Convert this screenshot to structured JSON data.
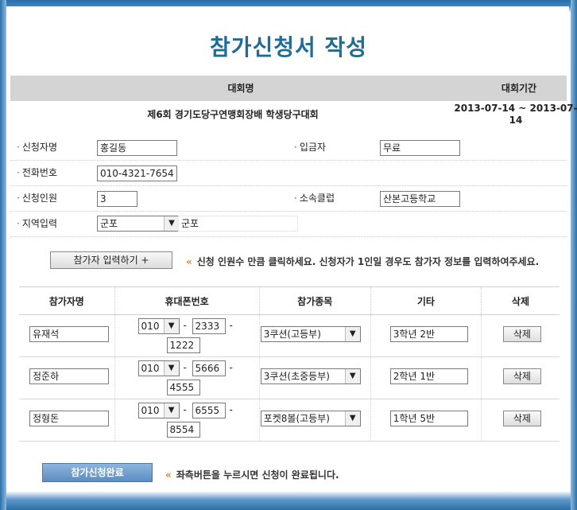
{
  "title": "참가신청서 작성",
  "event_table": {
    "col_name": "대회명",
    "col_period": "대회기간",
    "name": "제6회 경기도당구연맹회장배 학생당구대회",
    "period": "2013-07-14 ~ 2013-07-14"
  },
  "form": {
    "applicant_label": "신청자명",
    "applicant_value": "홍길동",
    "depositor_label": "입금자",
    "depositor_value": "무료",
    "phone_label": "전화번호",
    "phone_value": "010-4321-7654",
    "count_label": "신청인원",
    "count_value": "3",
    "club_label": "소속클럽",
    "club_value": "산본고등학교",
    "region_label": "지역입력",
    "region_select": "군포",
    "region_value": "군포"
  },
  "add_button": "참가자 입력하기 +",
  "add_note": "신청 인원수 만큼 클릭하세요.  신청자가 1인일 경우도 참가자 정보를 입력하여주세요.",
  "table": {
    "headers": [
      "참가자명",
      "휴대폰번호",
      "참가종목",
      "기타",
      "삭제"
    ],
    "rows": [
      {
        "name": "유재석",
        "p1": "010",
        "p2": "2333",
        "p3": "1222",
        "event": "3쿠션(고등부)",
        "etc": "3학년 2반",
        "del": "삭제"
      },
      {
        "name": "정준하",
        "p1": "010",
        "p2": "5666",
        "p3": "4555",
        "event": "3쿠션(초중등부)",
        "etc": "2학년 1반",
        "del": "삭제"
      },
      {
        "name": "정형돈",
        "p1": "010",
        "p2": "6555",
        "p3": "8554",
        "event": "포켓8볼(고등부)",
        "etc": "1학년 5반",
        "del": "삭제"
      }
    ]
  },
  "submit_button": "참가신청완료",
  "submit_note": "좌측버튼을 누르시면 신청이 완료됩니다.",
  "icons": {
    "dropdown": "chevron-down-icon",
    "note_marker": "double-chevron-left-icon"
  },
  "colors": {
    "title": "#1f6c97",
    "frame": "#2a6fa8",
    "submit": "#5b8ec2",
    "note_marker": "#d9822b"
  }
}
